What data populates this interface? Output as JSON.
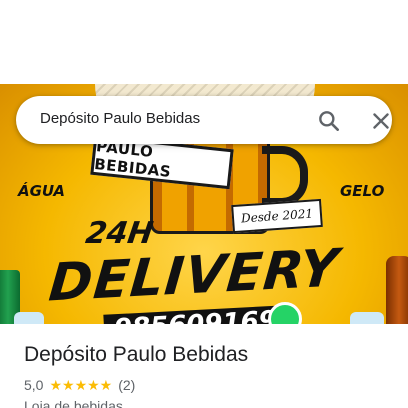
{
  "search": {
    "query": "Depósito Paulo Bebidas",
    "search_icon": "search-icon",
    "close_icon": "close-icon"
  },
  "banner": {
    "name_ribbon": "PAULO BEBIDAS",
    "since": "Desde 2021",
    "left_word": "ÁGUA",
    "right_word": "GELO",
    "hours": "24H",
    "headline": "DELIVERY",
    "phone_partial": "985609169",
    "whatsapp_icon": "whatsapp-icon"
  },
  "place": {
    "title": "Depósito Paulo Bebidas",
    "rating": "5,0",
    "stars": "★★★★★",
    "review_count": "(2)",
    "category": "Loja de bebidas"
  },
  "colors": {
    "banner_yellow": "#f5b800",
    "star_yellow": "#fbbc04",
    "text_primary": "#202124",
    "text_secondary": "#5f6368"
  }
}
